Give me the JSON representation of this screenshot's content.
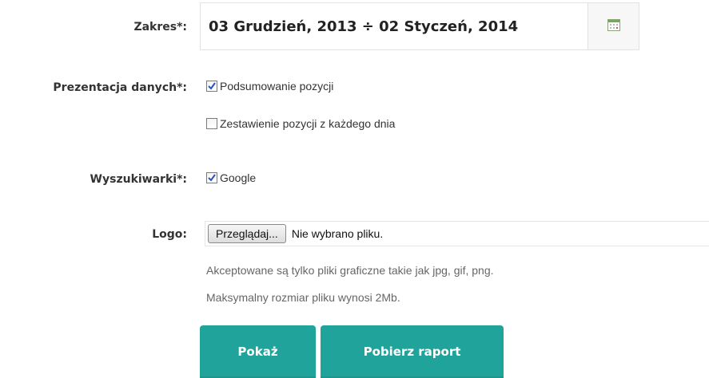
{
  "range": {
    "label": "Zakres*:",
    "value": "03 Grudzień, 2013 ÷ 02 Styczeń, 2014",
    "calendar_icon": "calendar-icon"
  },
  "presentation": {
    "label": "Prezentacja danych*:",
    "options": [
      {
        "label": "Podsumowanie pozycji",
        "checked": true
      },
      {
        "label": "Zestawienie pozycji z każdego dnia",
        "checked": false
      }
    ]
  },
  "search_engines": {
    "label": "Wyszukiwarki*:",
    "options": [
      {
        "label": "Google",
        "checked": true
      }
    ]
  },
  "logo": {
    "label": "Logo:",
    "browse_label": "Przeglądaj...",
    "file_status": "Nie wybrano pliku.",
    "hint_formats": "Akceptowane są tylko pliki graficzne takie jak jpg, gif, png.",
    "hint_size": "Maksymalny rozmiar pliku wynosi 2Mb."
  },
  "actions": {
    "show_label": "Pokaż",
    "download_label": "Pobierz raport"
  },
  "colors": {
    "accent": "#20a39a",
    "checkmark": "#2a52be"
  }
}
